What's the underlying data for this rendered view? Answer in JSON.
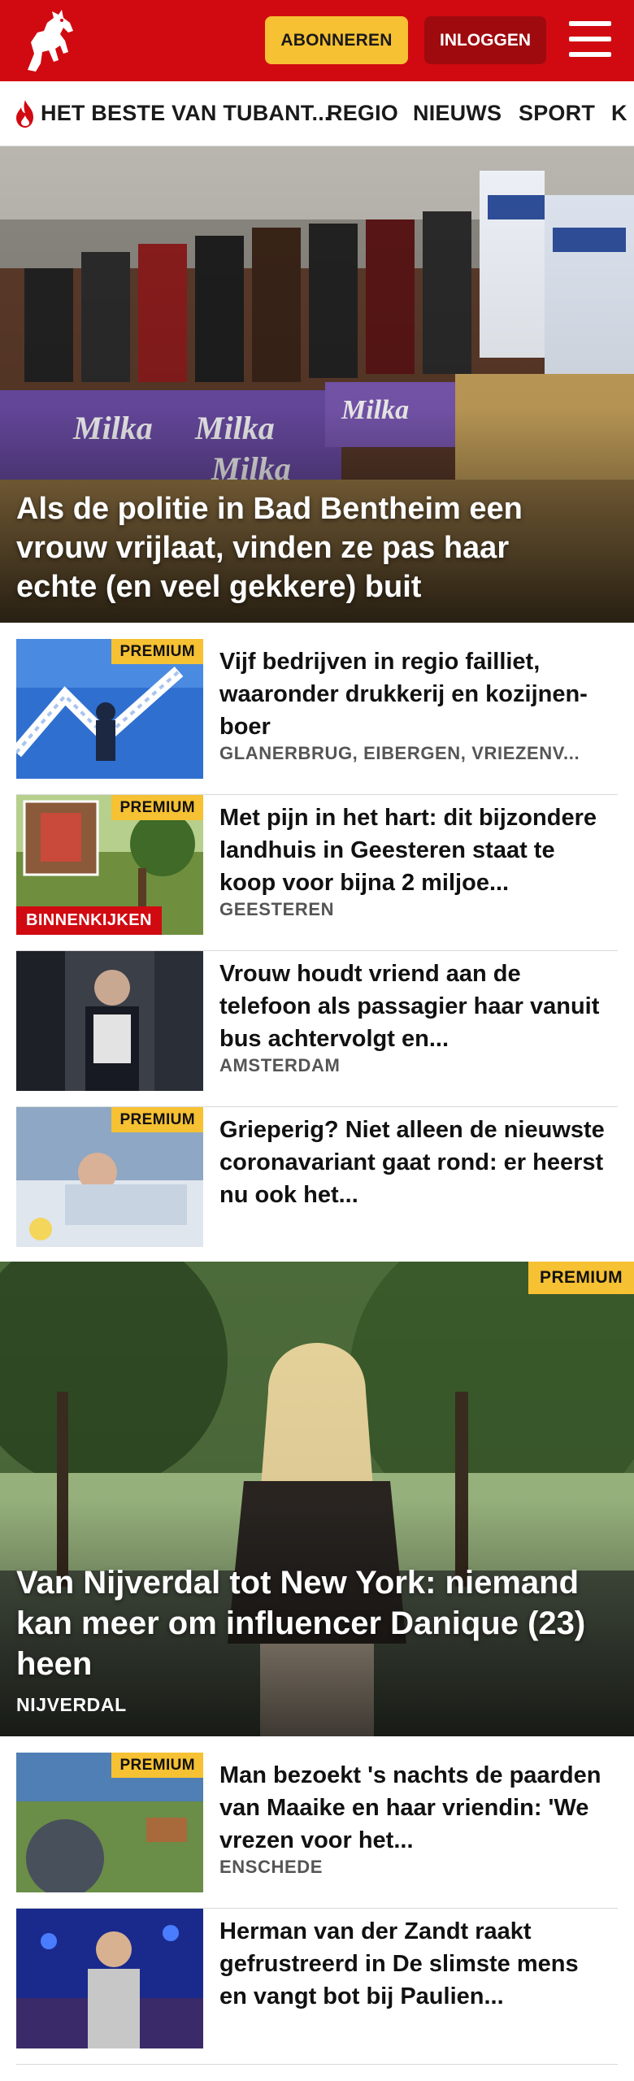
{
  "header": {
    "brand_color": "#d10a11",
    "logo_icon": "horse-logo-icon",
    "subscribe_label": "ABONNEREN",
    "login_label": "INLOGGEN",
    "menu_icon": "hamburger-menu-icon"
  },
  "nav": {
    "items": [
      {
        "label": "HET BESTE VAN TUBANT...",
        "icon": "flame-icon"
      },
      {
        "label": "REGIO"
      },
      {
        "label": "NIEUWS"
      },
      {
        "label": "SPORT"
      },
      {
        "label": "K"
      }
    ]
  },
  "hero": {
    "title": "Als de politie in Bad Bentheim een vrouw vrijlaat, vinden ze pas haar echte (en veel gekkere) buit"
  },
  "articles_top": [
    {
      "badge": "PREMIUM",
      "title": "Vijf bedrijven in regio failliet, waaronder drukkerij en kozijnen-boer",
      "location": "GLANERBRUG, EIBERGEN, VRIEZENV..."
    },
    {
      "badge": "PREMIUM",
      "label": "BINNENKIJKEN",
      "title": "Met pijn in het hart: dit bijzondere landhuis in Geesteren staat te koop voor bijna 2 miljoe...",
      "location": "GEESTEREN"
    },
    {
      "title": "Vrouw houdt vriend aan de telefoon als passagier haar vanuit bus achtervolgt en...",
      "location": "AMSTERDAM"
    },
    {
      "badge": "PREMIUM",
      "title": "Grieperig? Niet alleen de nieuwste coronavariant gaat rond: er heerst nu ook het..."
    }
  ],
  "feature": {
    "badge": "PREMIUM",
    "title": "Van Nijverdal tot New York: niemand kan meer om influencer Danique (23) heen",
    "location": "NIJVERDAL"
  },
  "articles_bottom": [
    {
      "badge": "PREMIUM",
      "title": "Man bezoekt 's nachts de paarden van Maaike en haar vriendin: 'We vrezen voor het...",
      "location": "ENSCHEDE"
    },
    {
      "title": "Herman van der Zandt raakt gefrustreerd in De slimste mens en vangt bot bij Paulien..."
    }
  ]
}
